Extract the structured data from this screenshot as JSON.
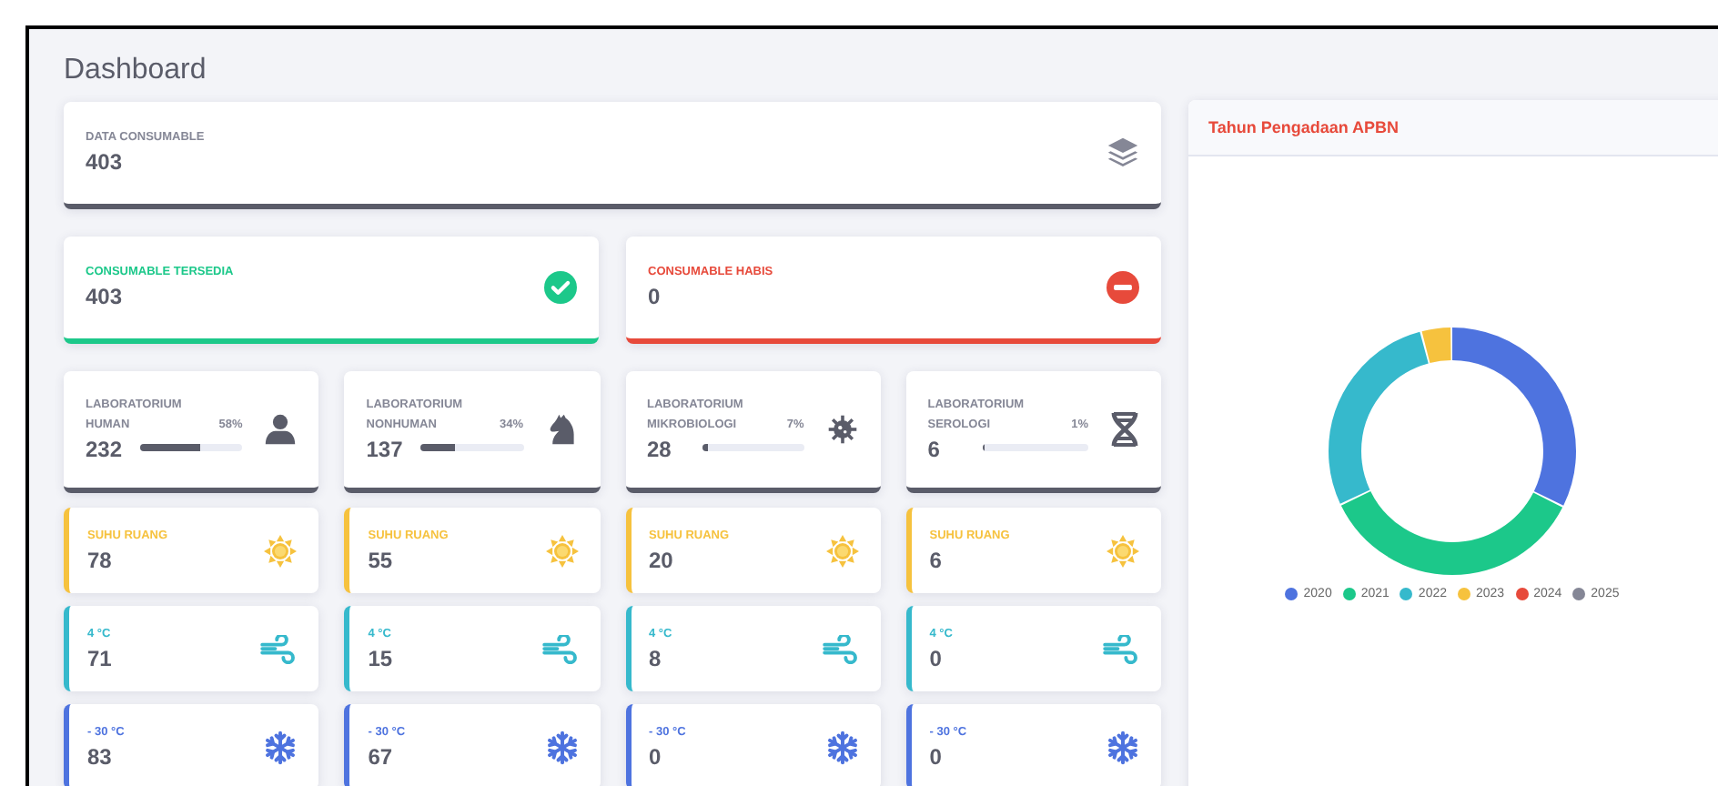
{
  "page_title": "Dashboard",
  "summary": {
    "label": "DATA CONSUMABLE",
    "value": "403"
  },
  "status_cards": [
    {
      "kind": "available",
      "label": "CONSUMABLE TERSEDIA",
      "value": "403",
      "color": "#1cc88a"
    },
    {
      "kind": "empty",
      "label": "CONSUMABLE HABIS",
      "value": "0",
      "color": "#e74a3b"
    }
  ],
  "labs": [
    {
      "kind": "human",
      "label": "LABORATORIUM HUMAN",
      "value": "232",
      "percent": "58%",
      "level": 0.58
    },
    {
      "kind": "nonhuman",
      "label": "LABORATORIUM NONHUMAN",
      "value": "137",
      "percent": "34%",
      "level": 0.34
    },
    {
      "kind": "micro",
      "label": "LABORATORIUM MIKROBIOLOGI",
      "value": "28",
      "percent": "7%",
      "level": 0.07
    },
    {
      "kind": "sero",
      "label": "LABORATORIUM SEROLOGI",
      "value": "6",
      "percent": "1%",
      "level": 0.01
    }
  ],
  "storage_rows": [
    {
      "kind": "room",
      "cards": [
        {
          "label": "SUHU RUANG",
          "value": "78"
        },
        {
          "label": "SUHU RUANG",
          "value": "55"
        },
        {
          "label": "SUHU RUANG",
          "value": "20"
        },
        {
          "label": "SUHU RUANG",
          "value": "6"
        }
      ]
    },
    {
      "kind": "cool",
      "cards": [
        {
          "label": "4 °C",
          "value": "71"
        },
        {
          "label": "4 °C",
          "value": "15"
        },
        {
          "label": "4 °C",
          "value": "8"
        },
        {
          "label": "4 °C",
          "value": "0"
        }
      ]
    },
    {
      "kind": "freeze",
      "cards": [
        {
          "label": "- 30 °C",
          "value": "83"
        },
        {
          "label": "- 30 °C",
          "value": "67"
        },
        {
          "label": "- 30 °C",
          "value": "0"
        },
        {
          "label": "- 30 °C",
          "value": "0"
        }
      ]
    }
  ],
  "chart_panel": {
    "title": "Tahun Pengadaan APBN",
    "legend": [
      {
        "label": "2020",
        "color": "#4e73df"
      },
      {
        "label": "2021",
        "color": "#1cc88a"
      },
      {
        "label": "2022",
        "color": "#36b9cc"
      },
      {
        "label": "2023",
        "color": "#f6c23e"
      },
      {
        "label": "2024",
        "color": "#e74a3b"
      },
      {
        "label": "2025",
        "color": "#858796"
      }
    ]
  }
}
